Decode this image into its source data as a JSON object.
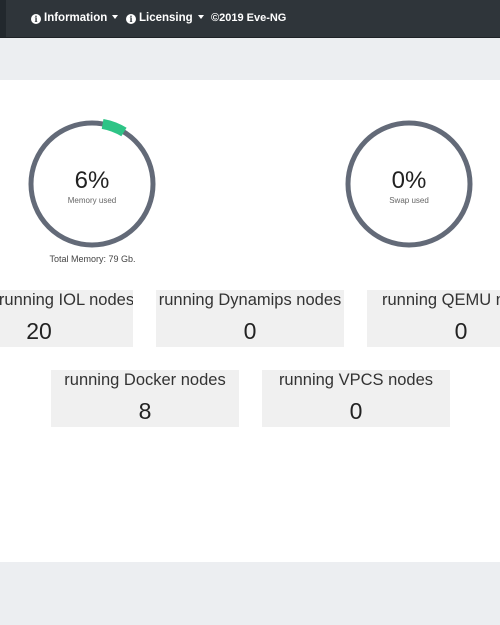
{
  "navbar": {
    "information_label": "Information",
    "licensing_label": "Licensing",
    "copyright": "©2019 Eve-NG"
  },
  "gauges": {
    "memory": {
      "value_text": "6%",
      "percent": 6,
      "label": "Memory used",
      "total_text": "Total Memory: 79 Gb."
    },
    "swap": {
      "value_text": "0%",
      "percent": 0,
      "label": "Swap used"
    }
  },
  "stats": [
    {
      "label": "running IOL nodes",
      "value": "20"
    },
    {
      "label": "running Dynamips nodes",
      "value": "0"
    },
    {
      "label": "running QEMU nodes",
      "value": "0"
    },
    {
      "label": "running Docker nodes",
      "value": "8"
    },
    {
      "label": "running VPCS nodes",
      "value": "0"
    }
  ],
  "colors": {
    "navbar_bg": "#2f353a",
    "gauge_track": "#636a78",
    "gauge_fill": "#2ec486",
    "stat_bg": "#f0f0f0"
  }
}
